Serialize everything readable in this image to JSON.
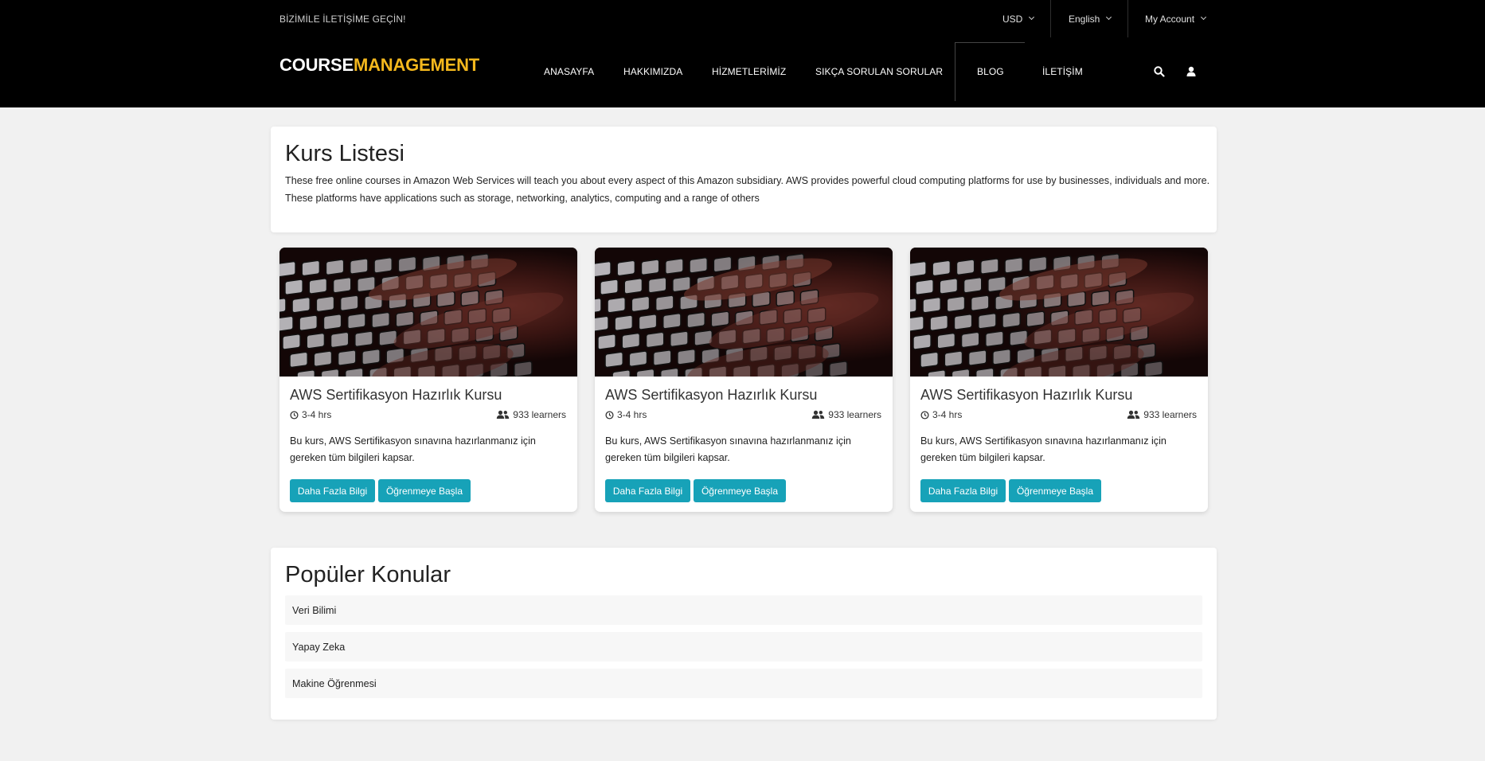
{
  "topbar": {
    "contact": "BİZİMİLE İLETİŞİME GEÇİN!",
    "currency": "USD",
    "language": "English",
    "account": "My Account"
  },
  "logo": {
    "part1": "COURSE",
    "part2": "MANAGEMENT"
  },
  "nav": {
    "items": [
      "ANASAYFA",
      "HAKKIMIZDA",
      "HİZMETLERİMİZ",
      "SIKÇA SORULAN SORULAR",
      "BLOG",
      "İLETİŞİM"
    ],
    "active": "BLOG",
    "icons": [
      "search-icon",
      "user-icon"
    ]
  },
  "courses": {
    "title": "Kurs Listesi",
    "description": "These free online courses in Amazon Web Services will teach you about every aspect of this Amazon subsidiary. AWS provides powerful cloud computing platforms for use by businesses, individuals and more. These platforms have applications such as storage, networking, analytics, computing and a range of others",
    "cards": [
      {
        "title": "AWS Sertifikasyon Hazırlık Kursu",
        "duration": "3-4 hrs",
        "learners": "933 learners",
        "description": "Bu kurs, AWS Sertifikasyon sınavına hazırlanmanız için gereken tüm bilgileri kapsar.",
        "btn_info": "Daha Fazla Bilgi",
        "btn_start": "Öğrenmeye Başla"
      },
      {
        "title": "AWS Sertifikasyon Hazırlık Kursu",
        "duration": "3-4 hrs",
        "learners": "933 learners",
        "description": "Bu kurs, AWS Sertifikasyon sınavına hazırlanmanız için gereken tüm bilgileri kapsar.",
        "btn_info": "Daha Fazla Bilgi",
        "btn_start": "Öğrenmeye Başla"
      },
      {
        "title": "AWS Sertifikasyon Hazırlık Kursu",
        "duration": "3-4 hrs",
        "learners": "933 learners",
        "description": "Bu kurs, AWS Sertifikasyon sınavına hazırlanmanız için gereken tüm bilgileri kapsar.",
        "btn_info": "Daha Fazla Bilgi",
        "btn_start": "Öğrenmeye Başla"
      }
    ]
  },
  "topics": {
    "title": "Popüler Konular",
    "items": [
      "Veri Bilimi",
      "Yapay Zeka",
      "Makine Öğrenmesi"
    ]
  },
  "colors": {
    "accent": "#17a2b8",
    "brand_yellow": "#f4b81d",
    "header_bg": "#000000"
  }
}
